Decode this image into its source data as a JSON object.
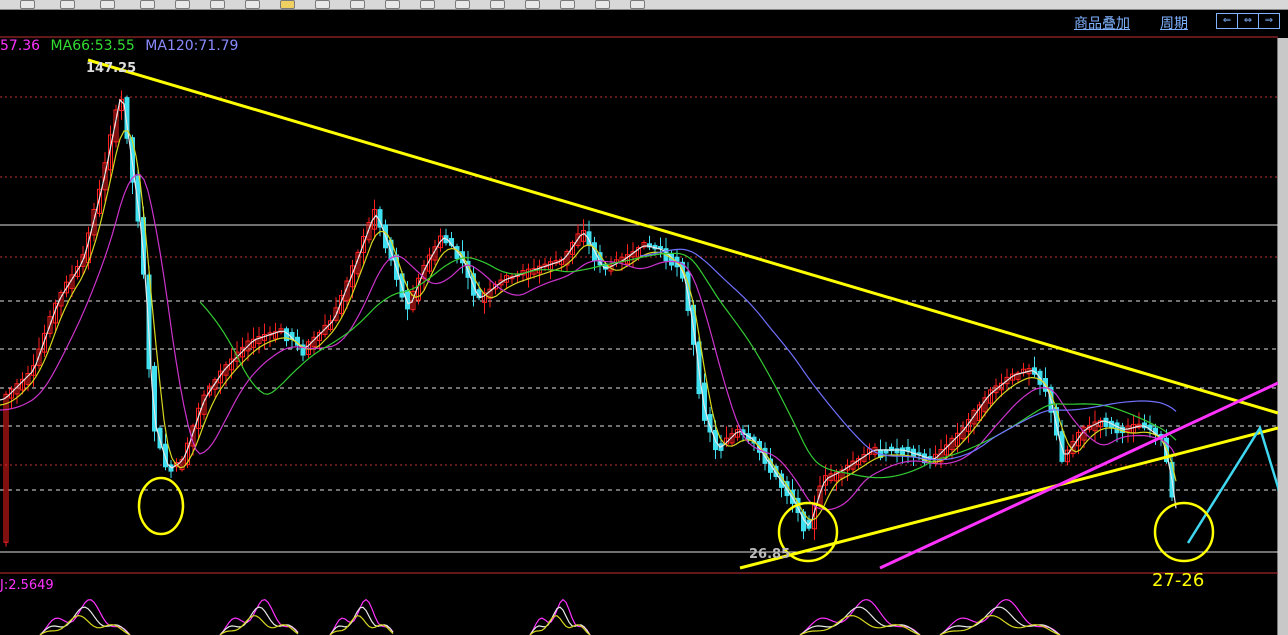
{
  "top_links": {
    "overlay": "商品叠加",
    "period": "周期"
  },
  "nav_arrows": [
    "⇐",
    "⇔",
    "⇒"
  ],
  "ma_legend": [
    {
      "label": "57.36",
      "color": "#ff33ff"
    },
    {
      "label": "MA66:53.55",
      "color": "#33dd33"
    },
    {
      "label": "MA120:71.79",
      "color": "#8a8aff"
    }
  ],
  "annotations": {
    "high": "147.25",
    "low": "26.85",
    "target": "27-26"
  },
  "indicator": {
    "label": "J:2.5649"
  },
  "colors": {
    "up": "#ff2020",
    "down": "#40e0f0",
    "trend": "#ffff00",
    "support2": "#ff33ff",
    "projection": "#40d8f0",
    "grid": "#c03030"
  },
  "chart_data": {
    "type": "candlestick",
    "high_label": "147.25",
    "low_label": "26.85",
    "ma_values": {
      "MA66": 53.55,
      "MA120": 71.79
    },
    "price_range": [
      26.85,
      147.25
    ],
    "grid": true
  }
}
